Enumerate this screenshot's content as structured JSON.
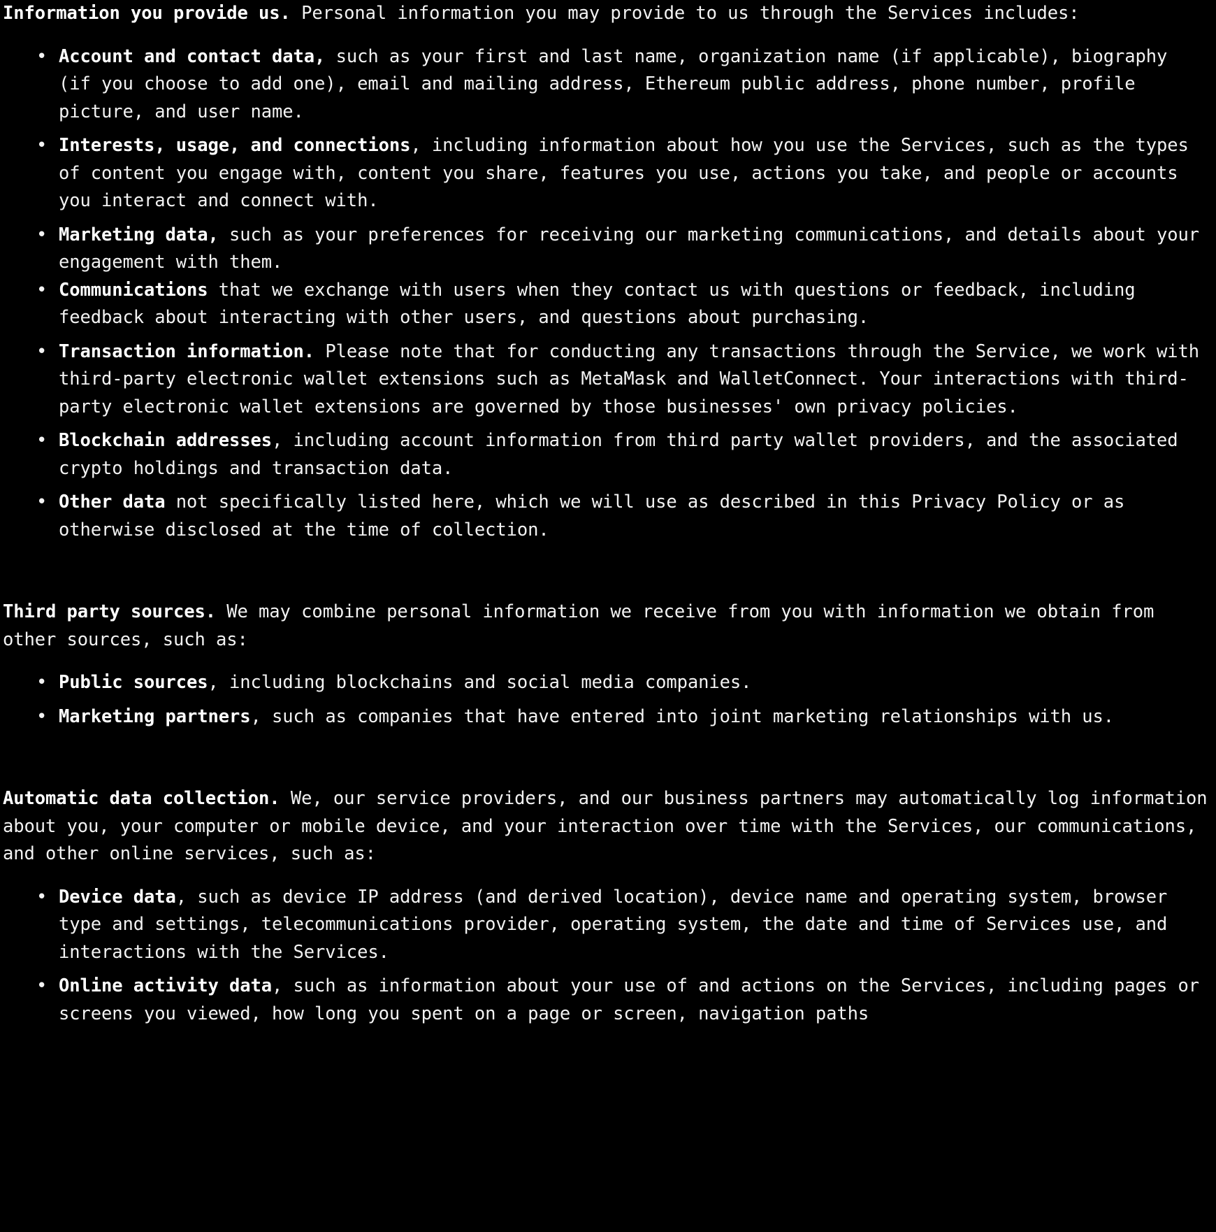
{
  "document": {
    "type": "privacy-policy-text",
    "background_color": "#000000",
    "text_color": "#f2f2f2",
    "sections": [
      {
        "id": "information-you-provide-us",
        "lead": "Information you provide us.",
        "body": " Personal information you may provide to us through the Services includes:",
        "bullets": [
          {
            "lead": "Account and contact data,",
            "body": " such as your first and last name, organization name (if applicable), biography (if you choose to add one), email and mailing address, Ethereum public address, phone number, profile picture, and user name."
          },
          {
            "lead": "Interests, usage, and connections",
            "body": ", including information about how you use the Services, such as the types of content you engage with, content you share, features you use, actions you take, and people or accounts you interact and connect with."
          },
          {
            "lead": "Marketing data,",
            "body": " such as your preferences for receiving our marketing communications, and details about your engagement with them."
          },
          {
            "lead": "Communications",
            "body": " that we exchange with users when they contact us with questions or feedback, including feedback about interacting with other users, and questions about purchasing."
          },
          {
            "lead": "Transaction information.",
            "body": " Please note that for conducting any transactions through the Service, we work with third-party electronic wallet extensions such as MetaMask and WalletConnect. Your interactions with third-party electronic wallet extensions are governed by those businesses' own privacy policies."
          },
          {
            "lead": "Blockchain addresses",
            "body": ", including account information from third party wallet providers, and the associated crypto holdings and transaction data."
          },
          {
            "lead": "Other data",
            "body": " not specifically listed here, which we will use as described in this Privacy Policy or as otherwise disclosed at the time of collection."
          }
        ]
      },
      {
        "id": "third-party-sources",
        "lead": "Third party sources.",
        "body": " We may combine personal information we receive from you with information we obtain from other sources, such as:",
        "bullets": [
          {
            "lead": "Public sources",
            "body": ", including blockchains and social media companies."
          },
          {
            "lead": "Marketing partners",
            "body": ", such as companies that have entered into joint marketing relationships with us."
          }
        ]
      },
      {
        "id": "automatic-data-collection",
        "lead": "Automatic data collection.",
        "body": " We, our service providers, and our business partners may automatically log information about you, your computer or mobile device, and your interaction over time with the Services, our communications, and other online services, such as:",
        "bullets": [
          {
            "lead": "Device data",
            "body": ", such as device IP address (and derived location), device name and operating system, browser type and settings, telecommunications provider, operating system, the date and time of Services use, and interactions with the Services."
          },
          {
            "lead": "Online activity data",
            "body": ", such as information about your use of and actions on the Services, including pages or screens you viewed, how long you spent on a page or screen, navigation paths"
          }
        ]
      }
    ],
    "bullet_glyph": "•"
  }
}
